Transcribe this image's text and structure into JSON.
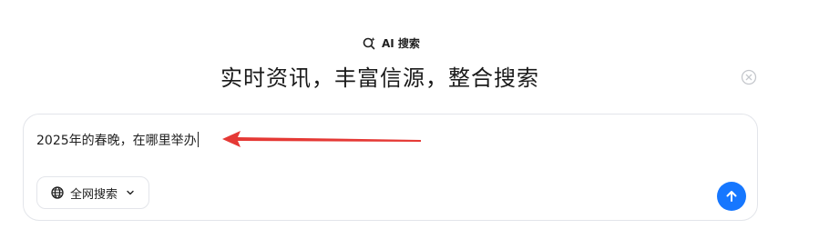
{
  "header": {
    "badge_label": "AI 搜索",
    "badge_icon": "ai-search-icon",
    "headline": "实时资讯，丰富信源，整合搜索"
  },
  "search": {
    "query": "2025年的春晚，在哪里举办",
    "scope_label": "全网搜索",
    "scope_icon": "globe-icon",
    "send_icon": "arrow-up-icon",
    "clear_icon": "close-circle-icon"
  },
  "colors": {
    "accent": "#1677ff",
    "annotation": "#e53935",
    "border": "#e3e5ea"
  }
}
